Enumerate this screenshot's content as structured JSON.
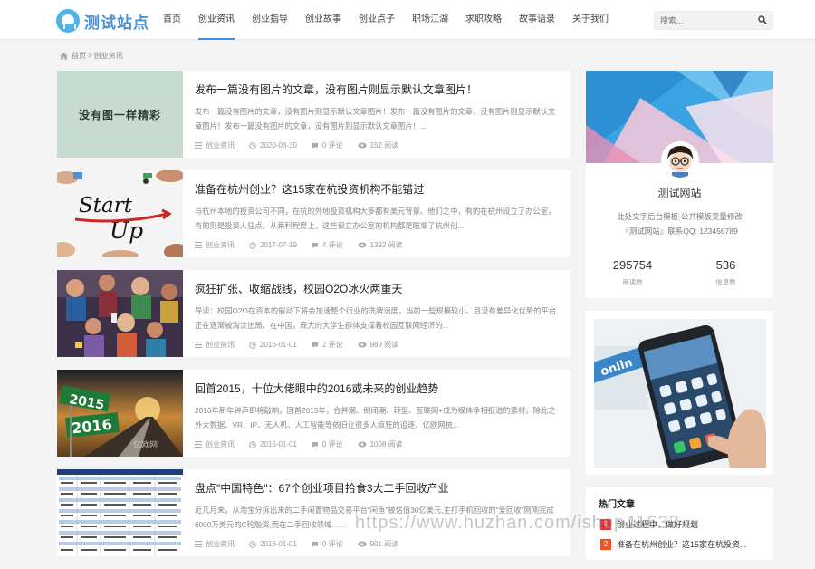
{
  "header": {
    "logo_text": "测试站点",
    "nav": [
      "首页",
      "创业资讯",
      "创业指导",
      "创业故事",
      "创业点子",
      "职场江湖",
      "求职攻略",
      "故事语录",
      "关于我们"
    ],
    "active_nav": "创业资讯",
    "search_placeholder": "搜索...",
    "accent_color": "#3c8de0"
  },
  "breadcrumb": {
    "home": "首页",
    "separator": ">",
    "current": "创业资讯"
  },
  "posts": [
    {
      "title": "发布一篇没有图片的文章，没有图片则显示默认文章图片！",
      "excerpt": "发布一篇没有图片的文章，没有图片则显示默认文章图片！发布一篇没有图片的文章，没有图片则显示默认文章图片！发布一篇没有图片的文章，没有图片则显示默认文章图片！...",
      "category": "创业资讯",
      "date": "2020-08-30",
      "comments": "0 评论",
      "views": "152 阅读",
      "thumb_text": "没有图一样精彩"
    },
    {
      "title": "准备在杭州创业？这15家在杭投资机构不能错过",
      "excerpt": "与杭州本地的投资公司不同，在杭的外地投资机构大多都有美元背景。他们之中，有的在杭州设立了办公室，有的则是投资人驻点。从莱科程度上，这些设立办公室的机构都是瞄准了杭州创...",
      "category": "创业资讯",
      "date": "2017-07-19",
      "comments": "4 评论",
      "views": "1392 阅读",
      "thumb_text": "Start Up"
    },
    {
      "title": "疯狂扩张、收缩战线，校园O2O冰火两重天",
      "excerpt": "导读：校园O2O在资本的催动下将会加速整个行业的洗牌速度，当前一些规模较小、且没有差异化优势的平台正在逐渐被淘汰出局。在中国，庞大的大学生群体支撑着校园互联网经济的...",
      "category": "创业资讯",
      "date": "2016-01-01",
      "comments": "2 评论",
      "views": "989 阅读"
    },
    {
      "title": "回首2015，十位大佬眼中的2016或未来的创业趋势",
      "excerpt": "2016年新年钟声即将敲响，回首2015年，合并潮、倒闭潮、转型、互联网+成为媒体争相报道的素材。除此之外大数据、VR、IP、无人机、人工智能等依旧让很多人疯狂的追逐。亿欧网梳...",
      "category": "创业资讯",
      "date": "2016-01-01",
      "comments": "0 评论",
      "views": "1008 阅读",
      "thumb_text": [
        "2015",
        "2016"
      ],
      "thumb_watermark": "亿欧网"
    },
    {
      "title": "盘点\"中国特色\"：67个创业项目拾食3大二手回收产业",
      "excerpt": "近几月来，从淘宝分拆出来的二手闲置物品交易平台\"闲鱼\"被估值30亿美元,主打手机回收的\"爱回收\"刚刚完成6000万美元的C轮融资,而在二手回收领域……",
      "category": "创业资讯",
      "date": "2016-01-01",
      "comments": "0 评论",
      "views": "901 阅读"
    }
  ],
  "profile": {
    "name": "测试网站",
    "desc_line1": "此处文字后台模板-公共模板变量修改",
    "desc_line2": "『测试网站』联系QQ: 123456789",
    "stats": [
      {
        "num": "295754",
        "label": "阅读数"
      },
      {
        "num": "536",
        "label": "信息数"
      }
    ]
  },
  "hot": {
    "heading": "热门文章",
    "items": [
      {
        "rank": "1",
        "title": "创业过程中，做好规划",
        "color": "#e53935"
      },
      {
        "rank": "2",
        "title": "准备在杭州创业？这15家在杭投资...",
        "color": "#f4511e"
      }
    ]
  },
  "watermark": "https://www.huzhan.com/ishop41633"
}
